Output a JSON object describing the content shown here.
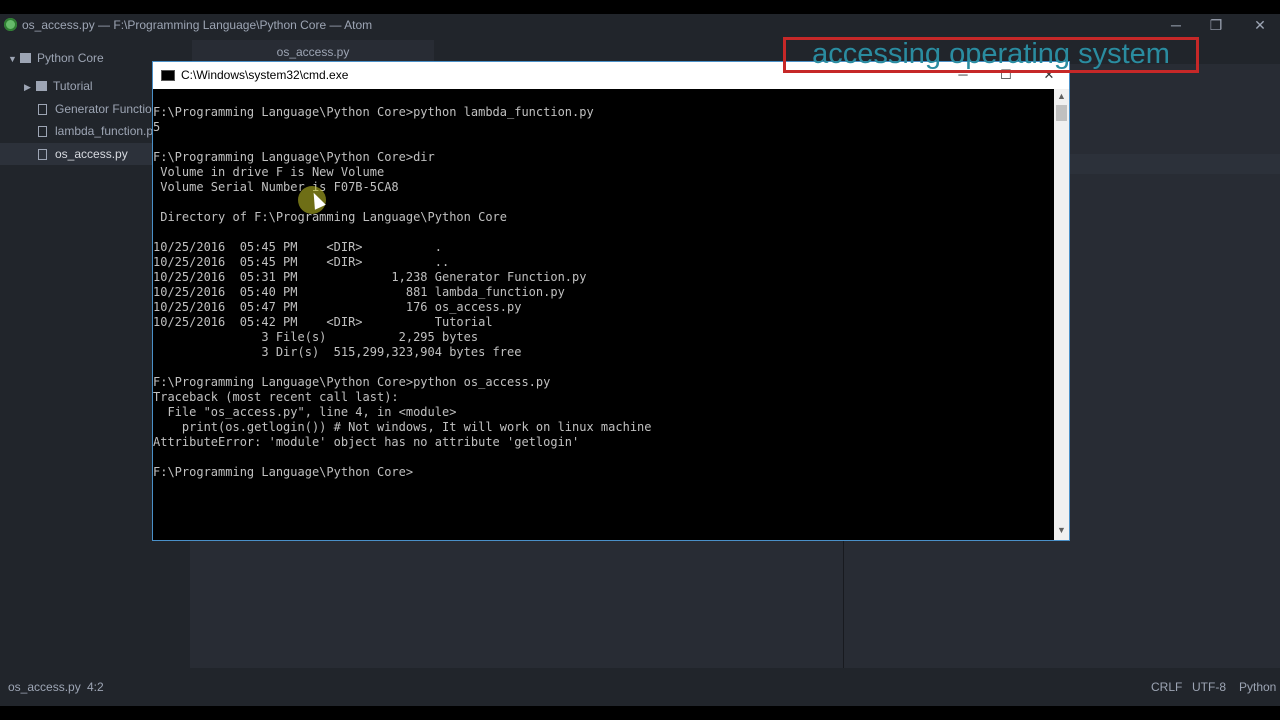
{
  "window": {
    "title": "os_access.py — F:\\Programming Language\\Python Core — Atom",
    "min_icon": "─",
    "max_icon": "❐",
    "close_icon": "✕"
  },
  "sidebar": {
    "root": "Python Core",
    "items": [
      {
        "label": "Tutorial",
        "type": "folder"
      },
      {
        "label": "Generator Function.py",
        "type": "file"
      },
      {
        "label": "lambda_function.py",
        "type": "file"
      },
      {
        "label": "os_access.py",
        "type": "file",
        "selected": true
      }
    ]
  },
  "editor": {
    "tab_label": "os_access.py"
  },
  "statusbar": {
    "file": "os_access.py",
    "cursor": "4:2",
    "line_ending": "CRLF",
    "encoding": "UTF-8",
    "grammar": "Python"
  },
  "cmd": {
    "title": "C:\\Windows\\system32\\cmd.exe",
    "min_icon": "─",
    "max_icon": "☐",
    "close_icon": "✕",
    "lines": [
      "F:\\Programming Language\\Python Core>python lambda_function.py",
      "5",
      "",
      "F:\\Programming Language\\Python Core>dir",
      " Volume in drive F is New Volume",
      " Volume Serial Number is F07B-5CA8",
      "",
      " Directory of F:\\Programming Language\\Python Core",
      "",
      "10/25/2016  05:45 PM    <DIR>          .",
      "10/25/2016  05:45 PM    <DIR>          ..",
      "10/25/2016  05:31 PM             1,238 Generator Function.py",
      "10/25/2016  05:40 PM               881 lambda_function.py",
      "10/25/2016  05:47 PM               176 os_access.py",
      "10/25/2016  05:42 PM    <DIR>          Tutorial",
      "               3 File(s)          2,295 bytes",
      "               3 Dir(s)  515,299,323,904 bytes free",
      "",
      "F:\\Programming Language\\Python Core>python os_access.py",
      "Traceback (most recent call last):",
      "  File \"os_access.py\", line 4, in <module>",
      "    print(os.getlogin()) # Not windows, It will work on linux machine",
      "AttributeError: 'module' object has no attribute 'getlogin'",
      "",
      "F:\\Programming Language\\Python Core>"
    ]
  },
  "overlay": {
    "caption": "accessing operating system"
  }
}
